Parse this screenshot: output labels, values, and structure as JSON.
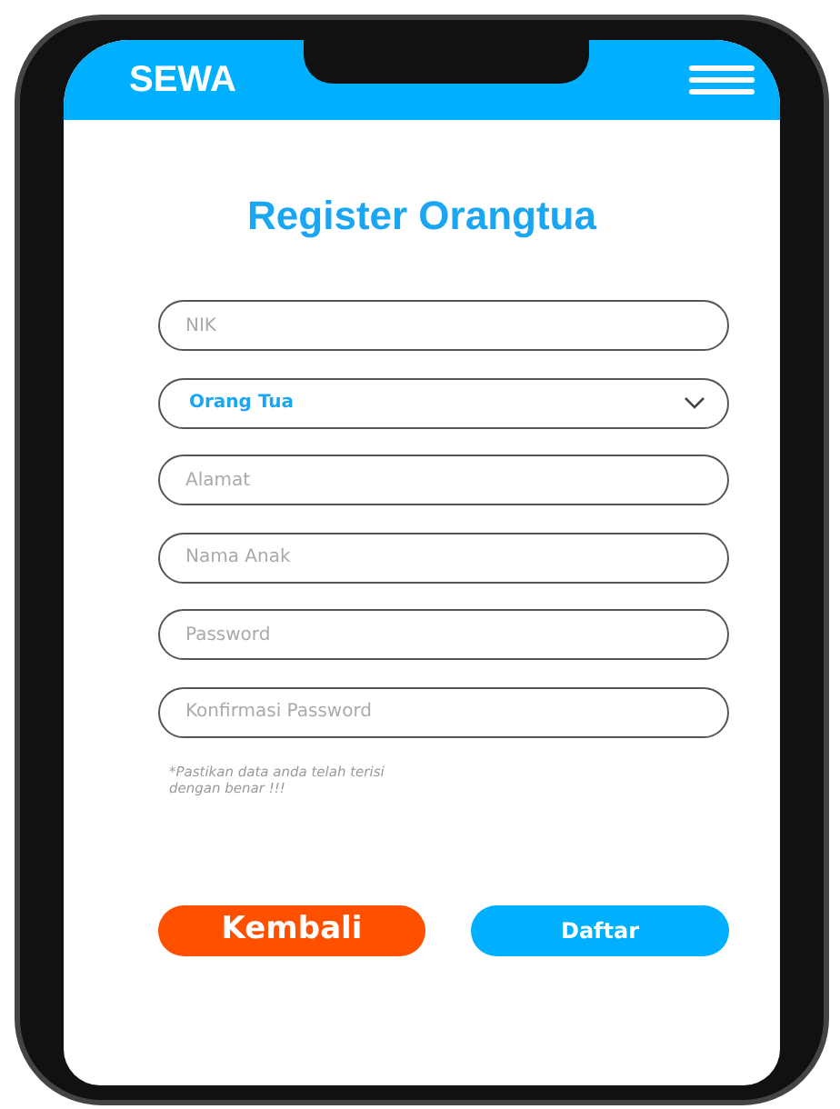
{
  "header": {
    "brand": "SEWA"
  },
  "title": "Register Orangtua",
  "fields": [
    {
      "kind": "input",
      "placeholder": "NIK"
    },
    {
      "kind": "select",
      "value": "Orang Tua"
    },
    {
      "kind": "input",
      "placeholder": "Alamat"
    },
    {
      "kind": "input",
      "placeholder": "Nama Anak"
    },
    {
      "kind": "input",
      "placeholder": "Password"
    },
    {
      "kind": "input",
      "placeholder": "Konfirmasi Password"
    }
  ],
  "note": "*Pastikan data anda telah terisi\ndengan benar !!!",
  "buttons": [
    {
      "label": "Kembali",
      "color": "#ff5000"
    },
    {
      "label": "Daftar",
      "color": "#00b0ff"
    }
  ]
}
